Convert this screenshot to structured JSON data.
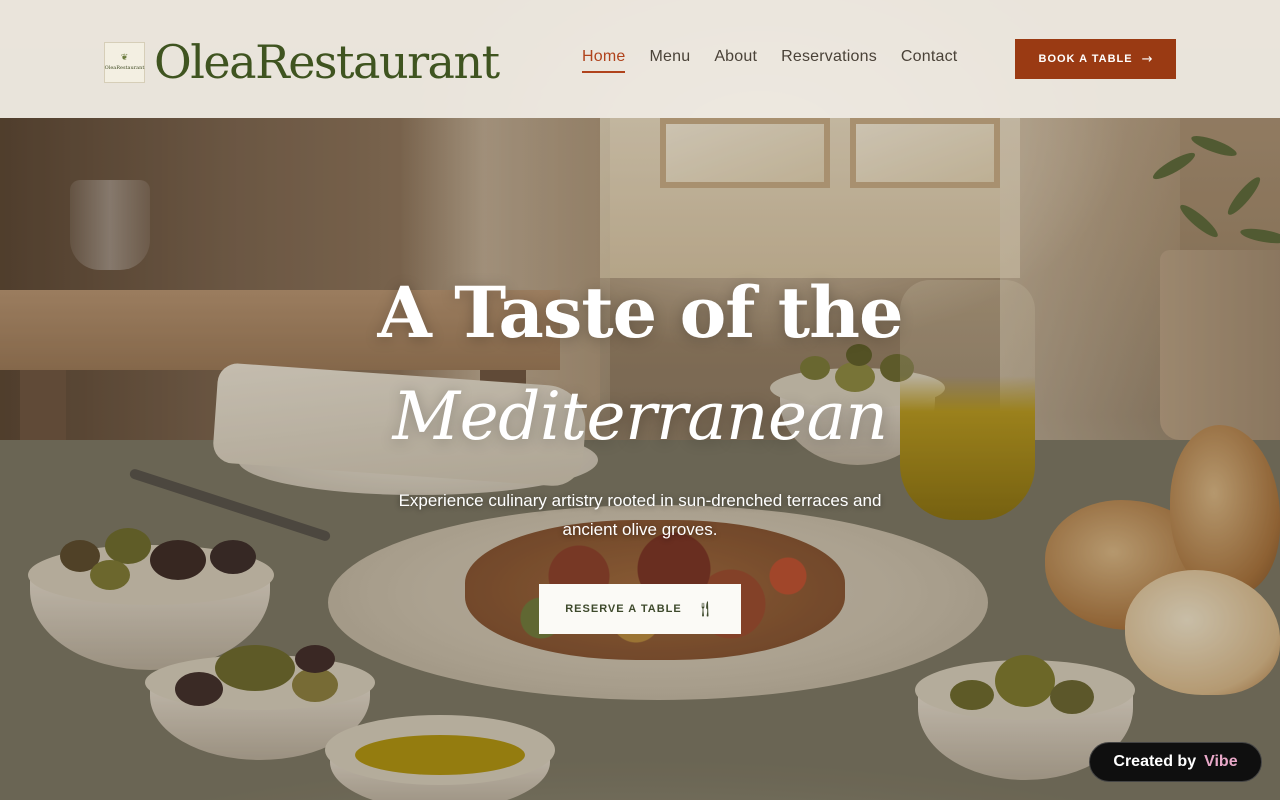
{
  "brand": {
    "name": "OleaRestaurant",
    "badge_text": "OleaRestaurant"
  },
  "nav": {
    "items": [
      {
        "label": "Home",
        "active": true
      },
      {
        "label": "Menu",
        "active": false
      },
      {
        "label": "About",
        "active": false
      },
      {
        "label": "Reservations",
        "active": false
      },
      {
        "label": "Contact",
        "active": false
      }
    ],
    "cta_label": "BOOK A TABLE",
    "cta_icon": "arrow-right-icon"
  },
  "hero": {
    "title_line1": "A Taste of the",
    "title_line2": "Mediterranean",
    "subtitle": "Experience culinary artistry rooted in sun-drenched terraces and ancient olive groves.",
    "cta_label": "RESERVE A TABLE",
    "cta_icon": "fork-knife-icon"
  },
  "badge": {
    "prefix": "Created by",
    "brand": "Vibe"
  },
  "colors": {
    "accent": "#9a3a13",
    "active_nav": "#b0431c",
    "brand_green": "#3f5420",
    "header_bg": "#f0ece4"
  }
}
